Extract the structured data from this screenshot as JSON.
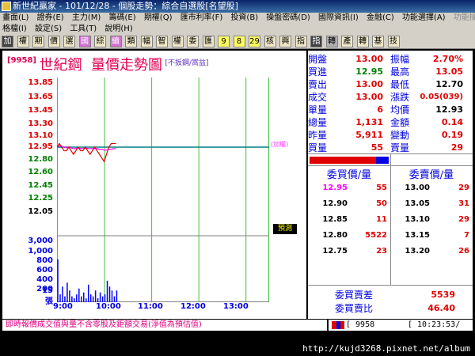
{
  "window": {
    "title": "新世紀贏家 - 101/12/28 - 個股走勢：綜合自選股[名望股]"
  },
  "menu": {
    "row1": [
      "畫面(L)",
      "證券(E)",
      "主力(M)",
      "籌碼(E)",
      "期權(Q)",
      "匯市利率(F)",
      "投資(B)",
      "操盤密碼(D)",
      "國際資訊(I)",
      "金融(C)",
      "功能選擇(A)",
      "功能操作(E)"
    ],
    "row2": [
      "格檔(I)",
      "設定(S)",
      "工具(T)",
      "說明(H)"
    ]
  },
  "toolbar": {
    "buttons": [
      "加",
      "權",
      "期",
      "價",
      "選",
      "國",
      "綜",
      "續",
      "類",
      "幅",
      "智",
      "權",
      "委",
      "匯",
      "9",
      "8",
      "29",
      "核",
      "興",
      "指",
      "指",
      "轉",
      "產",
      "轉",
      "基",
      "技"
    ]
  },
  "stock": {
    "code": "[9958]",
    "name": "世紀鋼",
    "chart_title": "量價走勢圖",
    "note": "[不扳鋼/嵩益]"
  },
  "chart_data": {
    "type": "line",
    "price_axis": {
      "ticks": [
        13.85,
        13.65,
        13.45,
        13.3,
        13.1,
        12.95,
        12.8,
        12.6,
        12.45,
        12.25,
        12.05
      ],
      "labels": [
        "13.85",
        "13.65",
        "13.45",
        "13.30",
        "13.10",
        "12.95",
        "12.80",
        "12.60",
        "12.45",
        "12.25",
        "12.05"
      ],
      "reference": 12.95
    },
    "volume_axis": {
      "ticks": [
        3000,
        1000,
        800,
        600,
        400,
        200,
        30,
        15
      ],
      "labels": [
        "3,000",
        "1,000",
        "800",
        "600",
        "400",
        "200",
        "30",
        "15"
      ],
      "unit": "張"
    },
    "time_labels": [
      "9:00",
      "10:00",
      "11:00",
      "12:00",
      "13:00"
    ],
    "price_series": {
      "x": [
        "9:00",
        "9:03",
        "9:06",
        "9:09",
        "9:12",
        "9:15",
        "9:18",
        "9:21",
        "9:24",
        "9:27",
        "9:30",
        "9:33",
        "9:36",
        "9:39",
        "9:42",
        "9:45",
        "9:48",
        "9:51",
        "9:54",
        "9:57",
        "10:00",
        "10:03",
        "10:06",
        "10:09",
        "10:12",
        "10:15"
      ],
      "values": [
        12.95,
        13.0,
        12.95,
        12.9,
        12.9,
        12.95,
        12.9,
        12.85,
        12.9,
        12.95,
        12.9,
        12.9,
        12.95,
        12.9,
        12.85,
        12.9,
        12.95,
        12.9,
        12.85,
        12.8,
        12.75,
        12.85,
        12.95,
        13.0,
        13.0,
        13.0
      ]
    },
    "avg_series": {
      "values": [
        12.95,
        12.97,
        12.96,
        12.95,
        12.94,
        12.95,
        12.94,
        12.93,
        12.93,
        12.94,
        12.93,
        12.93,
        12.94,
        12.93,
        12.93,
        12.93,
        12.93,
        12.93,
        12.92,
        12.92,
        12.91,
        12.91,
        12.92,
        12.92,
        12.93,
        12.93
      ]
    },
    "volume_series": {
      "values": [
        22,
        4,
        8,
        3,
        10,
        6,
        3,
        2,
        4,
        7,
        3,
        5,
        2,
        9,
        4,
        3,
        6,
        2,
        5,
        3,
        4,
        11,
        8,
        6,
        3,
        6
      ]
    },
    "colors": {
      "price": "#e00000",
      "avg": "#ff00ff",
      "reference": "#008080",
      "volume": "#0000ff",
      "grid": "#40c040"
    }
  },
  "labels": {
    "add_weight": "(加權)",
    "pre_open": "預測"
  },
  "quote": {
    "rows": [
      {
        "l1": "開盤",
        "v1": "13.00",
        "c1": "red",
        "l2": "振幅",
        "v2": "2.70%",
        "c2": "red"
      },
      {
        "l1": "買進",
        "v1": "12.95",
        "c1": "green",
        "l2": "最高",
        "v2": "13.05",
        "c2": "red"
      },
      {
        "l1": "賣出",
        "v1": "13.00",
        "c1": "red",
        "l2": "最低",
        "v2": "12.70",
        "c2": "black"
      },
      {
        "l1": "成交",
        "v1": "13.00",
        "c1": "red",
        "l2": "漲跌",
        "v2": "0.05(039)",
        "c2": "red"
      },
      {
        "l1": "單量",
        "v1": "6",
        "c1": "red",
        "l2": "均價",
        "v2": "12.93",
        "c2": "black"
      },
      {
        "l1": "總量",
        "v1": "1,131",
        "c1": "red",
        "l2": "金額",
        "v2": "0.14",
        "c2": "red"
      },
      {
        "l1": "昨量",
        "v1": "5,911",
        "c1": "red",
        "l2": "變動",
        "v2": "0.19",
        "c2": "red"
      },
      {
        "l1": "買量",
        "v1": "55",
        "c1": "red",
        "l2": "賣量",
        "v2": "29",
        "c2": "red"
      }
    ]
  },
  "orderbook": {
    "bid_header": "委買價/量",
    "ask_header": "委賣價/量",
    "bids": [
      {
        "price": "12.95",
        "vol": "55",
        "pc": "pink"
      },
      {
        "price": "12.90",
        "vol": "50",
        "pc": "black"
      },
      {
        "price": "12.85",
        "vol": "11",
        "pc": "black"
      },
      {
        "price": "12.80",
        "vol": "5522",
        "pc": "black"
      },
      {
        "price": "12.75",
        "vol": "23",
        "pc": "black"
      }
    ],
    "asks": [
      {
        "price": "13.00",
        "vol": "29",
        "pc": "red"
      },
      {
        "price": "13.05",
        "vol": "31",
        "pc": "red"
      },
      {
        "price": "13.10",
        "vol": "29",
        "pc": "red"
      },
      {
        "price": "13.15",
        "vol": "7",
        "pc": "red"
      },
      {
        "price": "13.20",
        "vol": "26",
        "pc": "red"
      }
    ],
    "diff_label": "委買賣差",
    "diff_value": "5539",
    "ratio_label": "委買賣比",
    "ratio_value": "46.40"
  },
  "status": {
    "message": "即時報價成交值與量不含零股及鉅額交易(淨值為預估值)",
    "code": "[ 9958",
    "time": "[ 10:23:53/"
  },
  "watermark": "http://kujd3268.pixnet.net/album"
}
